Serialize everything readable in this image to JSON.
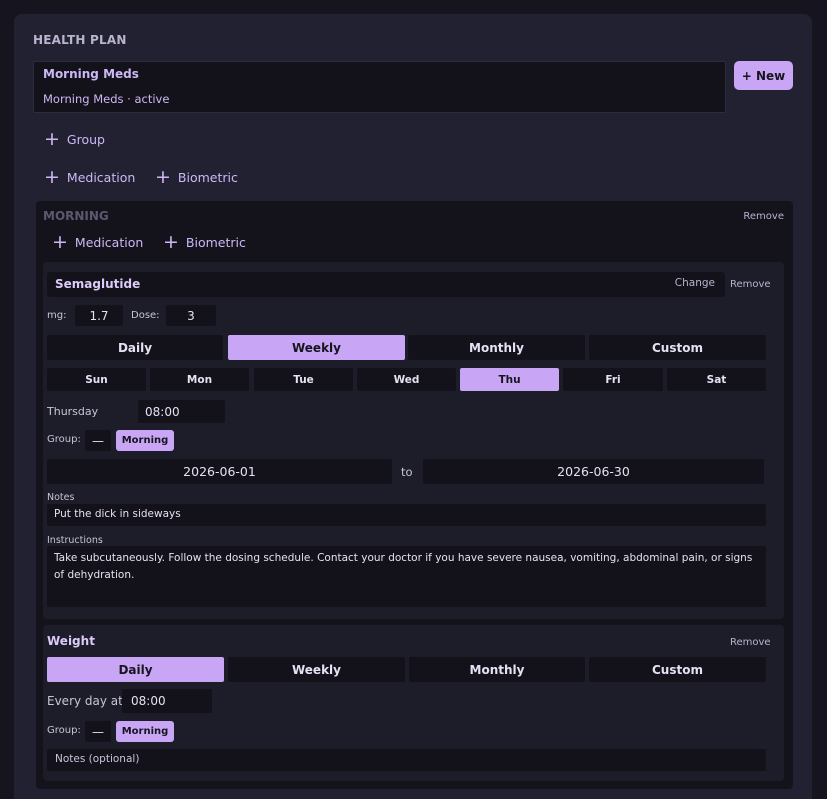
{
  "header": {
    "title": "HEALTH PLAN"
  },
  "plan": {
    "name": "Morning Meds",
    "subtitle": "Morning Meds · active",
    "new_label": "+ New"
  },
  "add_links": {
    "group": "Group",
    "medication": "Medication",
    "biometric": "Biometric"
  },
  "group": {
    "name": "MORNING",
    "remove_label": "Remove",
    "add_medication": "Medication",
    "add_biometric": "Biometric",
    "medication": {
      "name": "Semaglutide",
      "change_label": "Change",
      "remove_label": "Remove",
      "mg_label": "mg:",
      "mg_value": "1.7",
      "dose_label": "Dose:",
      "dose_value": "3",
      "frequency_options": [
        "Daily",
        "Weekly",
        "Monthly",
        "Custom"
      ],
      "frequency_selected": "Weekly",
      "days": [
        "Sun",
        "Mon",
        "Tue",
        "Wed",
        "Thu",
        "Fri",
        "Sat"
      ],
      "day_selected": "Thu",
      "time_label": "Thursday",
      "time_value": "08:00",
      "group_label": "Group:",
      "group_dash": "—",
      "group_value": "Morning",
      "start_date": "2026-06-01",
      "to_label": "to",
      "end_date": "2026-06-30",
      "notes_label": "Notes",
      "notes_value": "Put the dick in sideways",
      "instructions_label": "Instructions",
      "instructions_value": "Take subcutaneously. Follow the dosing schedule. Contact your doctor if you have severe nausea, vomiting, abdominal pain, or signs of dehydration."
    },
    "biometric": {
      "name": "Weight",
      "remove_label": "Remove",
      "frequency_options": [
        "Daily",
        "Weekly",
        "Monthly",
        "Custom"
      ],
      "frequency_selected": "Daily",
      "time_label": "Every day at",
      "time_value": "08:00",
      "group_label": "Group:",
      "group_dash": "—",
      "group_value": "Morning",
      "notes_placeholder": "Notes (optional)"
    }
  },
  "colors": {
    "accent": "#c8a6f5",
    "background": "#16151f",
    "panel": "#222131",
    "field": "#13121b"
  },
  "icons": {
    "add": "plus-icon"
  }
}
